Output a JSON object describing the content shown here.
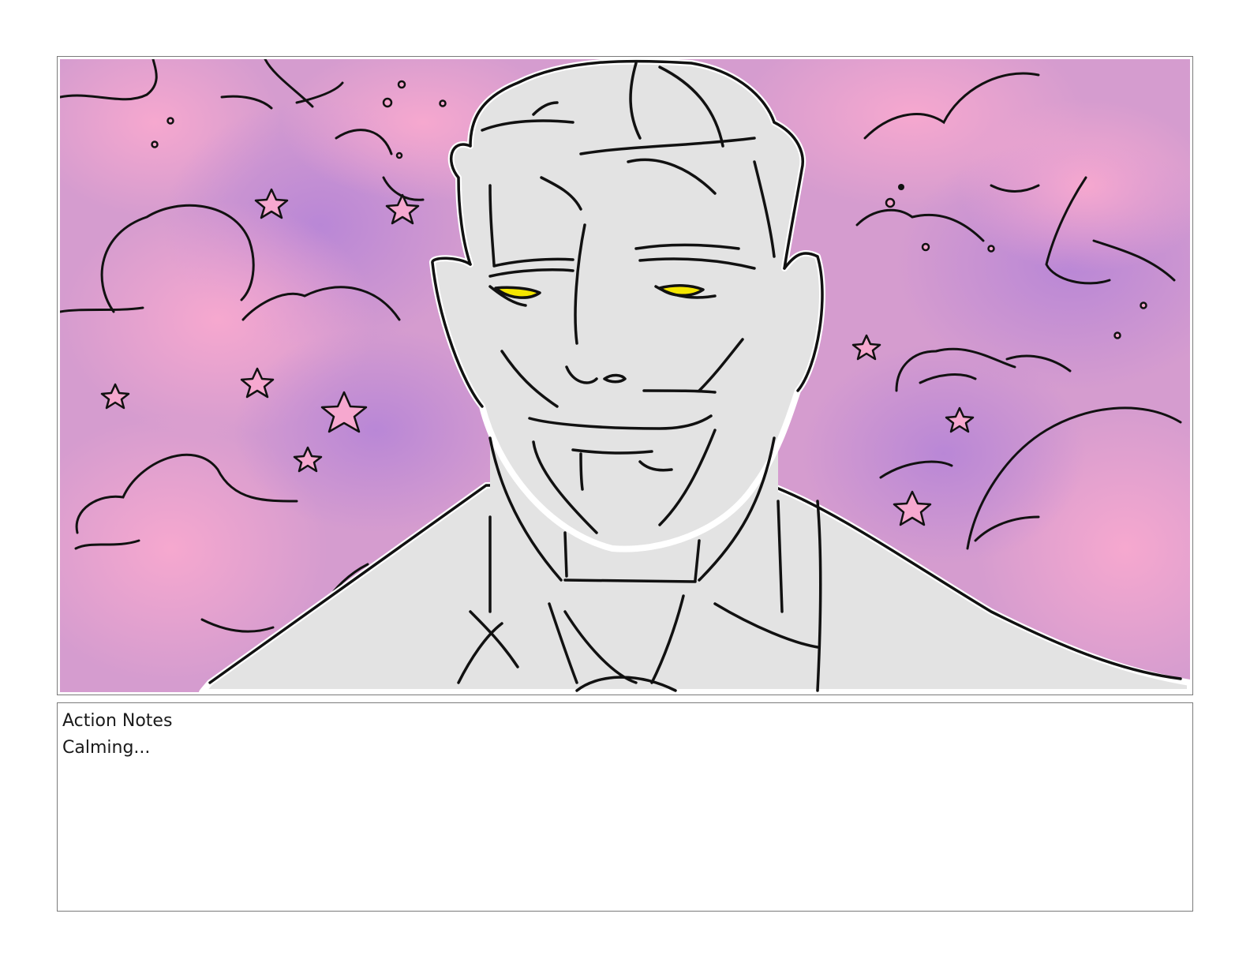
{
  "storyboard_panel": {
    "image_icon": "villain-portrait-icon",
    "colors": {
      "sky_pink": "#f0a6cf",
      "sky_purple": "#c38fd4",
      "figure_gray": "#e3e3e3",
      "eye_yellow": "#f5e600",
      "line": "#111111"
    }
  },
  "notes": {
    "label": "Action Notes",
    "text": "Calming..."
  }
}
